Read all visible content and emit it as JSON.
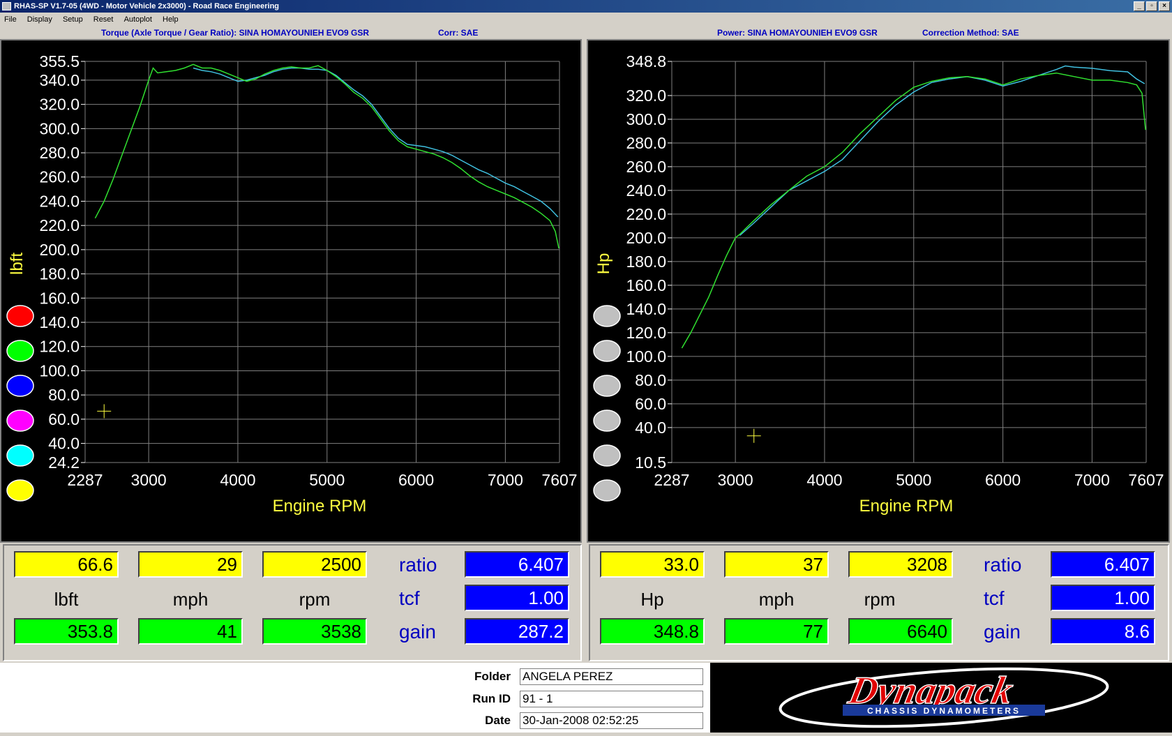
{
  "window": {
    "title": "RHAS-SP V1.7-05  (4WD - Motor Vehicle 2x3000) - Road Race Engineering"
  },
  "menu": [
    "File",
    "Display",
    "Setup",
    "Reset",
    "Autoplot",
    "Help"
  ],
  "torque_panel": {
    "title": "Torque (Axle Torque / Gear Ratio): SINA HOMAYOUNIEH EVO9 GSR",
    "corr": "Corr: SAE",
    "readout": {
      "val1": "66.6",
      "val2": "29",
      "val3": "2500",
      "unit1": "lbft",
      "unit2": "mph",
      "unit3": "rpm",
      "peak1": "353.8",
      "peak2": "41",
      "peak3": "3538",
      "ratio_label": "ratio",
      "tcf_label": "tcf",
      "gain_label": "gain",
      "ratio": "6.407",
      "tcf": "1.00",
      "gain": "287.2"
    }
  },
  "power_panel": {
    "title": "Power: SINA HOMAYOUNIEH EVO9 GSR",
    "corr": "Correction Method: SAE",
    "readout": {
      "val1": "33.0",
      "val2": "37",
      "val3": "3208",
      "unit1": "Hp",
      "unit2": "mph",
      "unit3": "rpm",
      "peak1": "348.8",
      "peak2": "77",
      "peak3": "6640",
      "ratio_label": "ratio",
      "tcf_label": "tcf",
      "gain_label": "gain",
      "ratio": "6.407",
      "tcf": "1.00",
      "gain": "8.6"
    }
  },
  "info": {
    "folder_label": "Folder",
    "folder": "ANGELA PEREZ",
    "runid_label": "Run ID",
    "runid": "91 - 1",
    "date_label": "Date",
    "date": "30-Jan-2008  02:52:25"
  },
  "logo": {
    "brand": "Dynapack",
    "tagline": "CHASSIS DYNAMOMETERS"
  },
  "colors": {
    "run_blue_curve": "#40c0e0",
    "run_green_curve": "#30e030",
    "axis_label": "#ffff40",
    "grid": "#808080"
  },
  "chart_data": [
    {
      "type": "line",
      "xlabel": "Engine RPM",
      "ylabel": "lbft",
      "xlim": [
        2287,
        7607
      ],
      "ylim": [
        24.2,
        355.5
      ],
      "xticks": [
        "2287",
        "3000",
        "4000",
        "5000",
        "6000",
        "7000",
        "7607"
      ],
      "xtick_values": [
        2287,
        3000,
        4000,
        5000,
        6000,
        7000,
        7607
      ],
      "yticks": [
        "355.5",
        "340.0",
        "320.0",
        "300.0",
        "280.0",
        "260.0",
        "240.0",
        "220.0",
        "200.0",
        "180.0",
        "160.0",
        "140.0",
        "120.0",
        "100.0",
        "80.0",
        "60.0",
        "40.0",
        "24.2"
      ],
      "ytick_values": [
        355.5,
        340,
        320,
        300,
        280,
        260,
        240,
        220,
        200,
        180,
        160,
        140,
        120,
        100,
        80,
        60,
        40,
        24.2
      ],
      "grid": true,
      "cursor": {
        "x": 2500,
        "y": 66.6
      },
      "legend_swatches": [
        "#ff0000",
        "#00ff00",
        "#0000ff",
        "#ff00ff",
        "#00ffff",
        "#ffff00"
      ],
      "series": [
        {
          "color": "#40c0e0",
          "x": [
            3500,
            3600,
            3700,
            3800,
            3900,
            4000,
            4100,
            4200,
            4300,
            4400,
            4500,
            4600,
            4700,
            4800,
            4900,
            5000,
            5100,
            5200,
            5300,
            5400,
            5500,
            5600,
            5700,
            5800,
            5900,
            6000,
            6100,
            6200,
            6300,
            6400,
            6500,
            6600,
            6700,
            6800,
            6900,
            7000,
            7100,
            7200,
            7300,
            7400,
            7500,
            7590
          ],
          "y": [
            350,
            348,
            347,
            345,
            342,
            339,
            340,
            342,
            344,
            347,
            349,
            350,
            350,
            349,
            349,
            348,
            344,
            338,
            332,
            327,
            320,
            310,
            300,
            292,
            287,
            286,
            285,
            283,
            281,
            278,
            274,
            270,
            266,
            263,
            259,
            255,
            252,
            248,
            244,
            240,
            234,
            227
          ]
        },
        {
          "color": "#30e030",
          "x": [
            2400,
            2500,
            2600,
            2700,
            2800,
            2900,
            3000,
            3050,
            3100,
            3200,
            3300,
            3400,
            3500,
            3600,
            3700,
            3800,
            3900,
            4000,
            4100,
            4200,
            4300,
            4400,
            4500,
            4600,
            4700,
            4800,
            4900,
            5000,
            5100,
            5200,
            5300,
            5400,
            5500,
            5600,
            5700,
            5800,
            5900,
            6000,
            6100,
            6200,
            6300,
            6400,
            6500,
            6600,
            6700,
            6800,
            6900,
            7000,
            7100,
            7200,
            7300,
            7400,
            7500,
            7560,
            7600
          ],
          "y": [
            226,
            240,
            258,
            278,
            298,
            318,
            340,
            350,
            346,
            347,
            348,
            350,
            353,
            350,
            350,
            348,
            345,
            342,
            339,
            341,
            345,
            348,
            350,
            351,
            350,
            350,
            352,
            348,
            343,
            337,
            330,
            325,
            318,
            308,
            298,
            290,
            285,
            283,
            281,
            279,
            276,
            272,
            267,
            261,
            256,
            252,
            249,
            246,
            243,
            239,
            235,
            230,
            224,
            215,
            201
          ]
        }
      ]
    },
    {
      "type": "line",
      "xlabel": "Engine RPM",
      "ylabel": "Hp",
      "xlim": [
        2287,
        7607
      ],
      "ylim": [
        10.5,
        348.8
      ],
      "xticks": [
        "2287",
        "3000",
        "4000",
        "5000",
        "6000",
        "7000",
        "7607"
      ],
      "xtick_values": [
        2287,
        3000,
        4000,
        5000,
        6000,
        7000,
        7607
      ],
      "yticks": [
        "348.8",
        "320.0",
        "300.0",
        "280.0",
        "260.0",
        "240.0",
        "220.0",
        "200.0",
        "180.0",
        "160.0",
        "140.0",
        "120.0",
        "100.0",
        "80.0",
        "60.0",
        "40.0",
        "10.5"
      ],
      "ytick_values": [
        348.8,
        320,
        300,
        280,
        260,
        240,
        220,
        200,
        180,
        160,
        140,
        120,
        100,
        80,
        60,
        40,
        10.5
      ],
      "grid": true,
      "cursor": {
        "x": 3208,
        "y": 33.0
      },
      "legend_swatches": [
        "#c0c0c0",
        "#c0c0c0",
        "#c0c0c0",
        "#c0c0c0",
        "#c0c0c0",
        "#c0c0c0"
      ],
      "series": [
        {
          "color": "#40c0e0",
          "x": [
            3050,
            3200,
            3400,
            3600,
            3800,
            4000,
            4200,
            4400,
            4600,
            4800,
            5000,
            5200,
            5400,
            5600,
            5800,
            6000,
            6200,
            6400,
            6600,
            6700,
            6800,
            7000,
            7200,
            7400,
            7500,
            7590
          ],
          "y": [
            202,
            212,
            226,
            240,
            248,
            256,
            266,
            282,
            298,
            312,
            323,
            331,
            334,
            336,
            333,
            328,
            332,
            337,
            342,
            345,
            344,
            343,
            341,
            340,
            334,
            330
          ]
        },
        {
          "color": "#30e030",
          "x": [
            2400,
            2500,
            2600,
            2700,
            2800,
            2900,
            3000,
            3050,
            3200,
            3400,
            3600,
            3800,
            4000,
            4200,
            4400,
            4600,
            4800,
            5000,
            5200,
            5400,
            5600,
            5800,
            6000,
            6200,
            6400,
            6600,
            6800,
            7000,
            7200,
            7400,
            7500,
            7560,
            7600
          ],
          "y": [
            107,
            120,
            135,
            150,
            168,
            185,
            200,
            203,
            214,
            228,
            240,
            252,
            260,
            272,
            288,
            302,
            316,
            327,
            332,
            335,
            336,
            334,
            329,
            334,
            337,
            339,
            336,
            333,
            333,
            331,
            329,
            322,
            291
          ]
        }
      ]
    }
  ]
}
